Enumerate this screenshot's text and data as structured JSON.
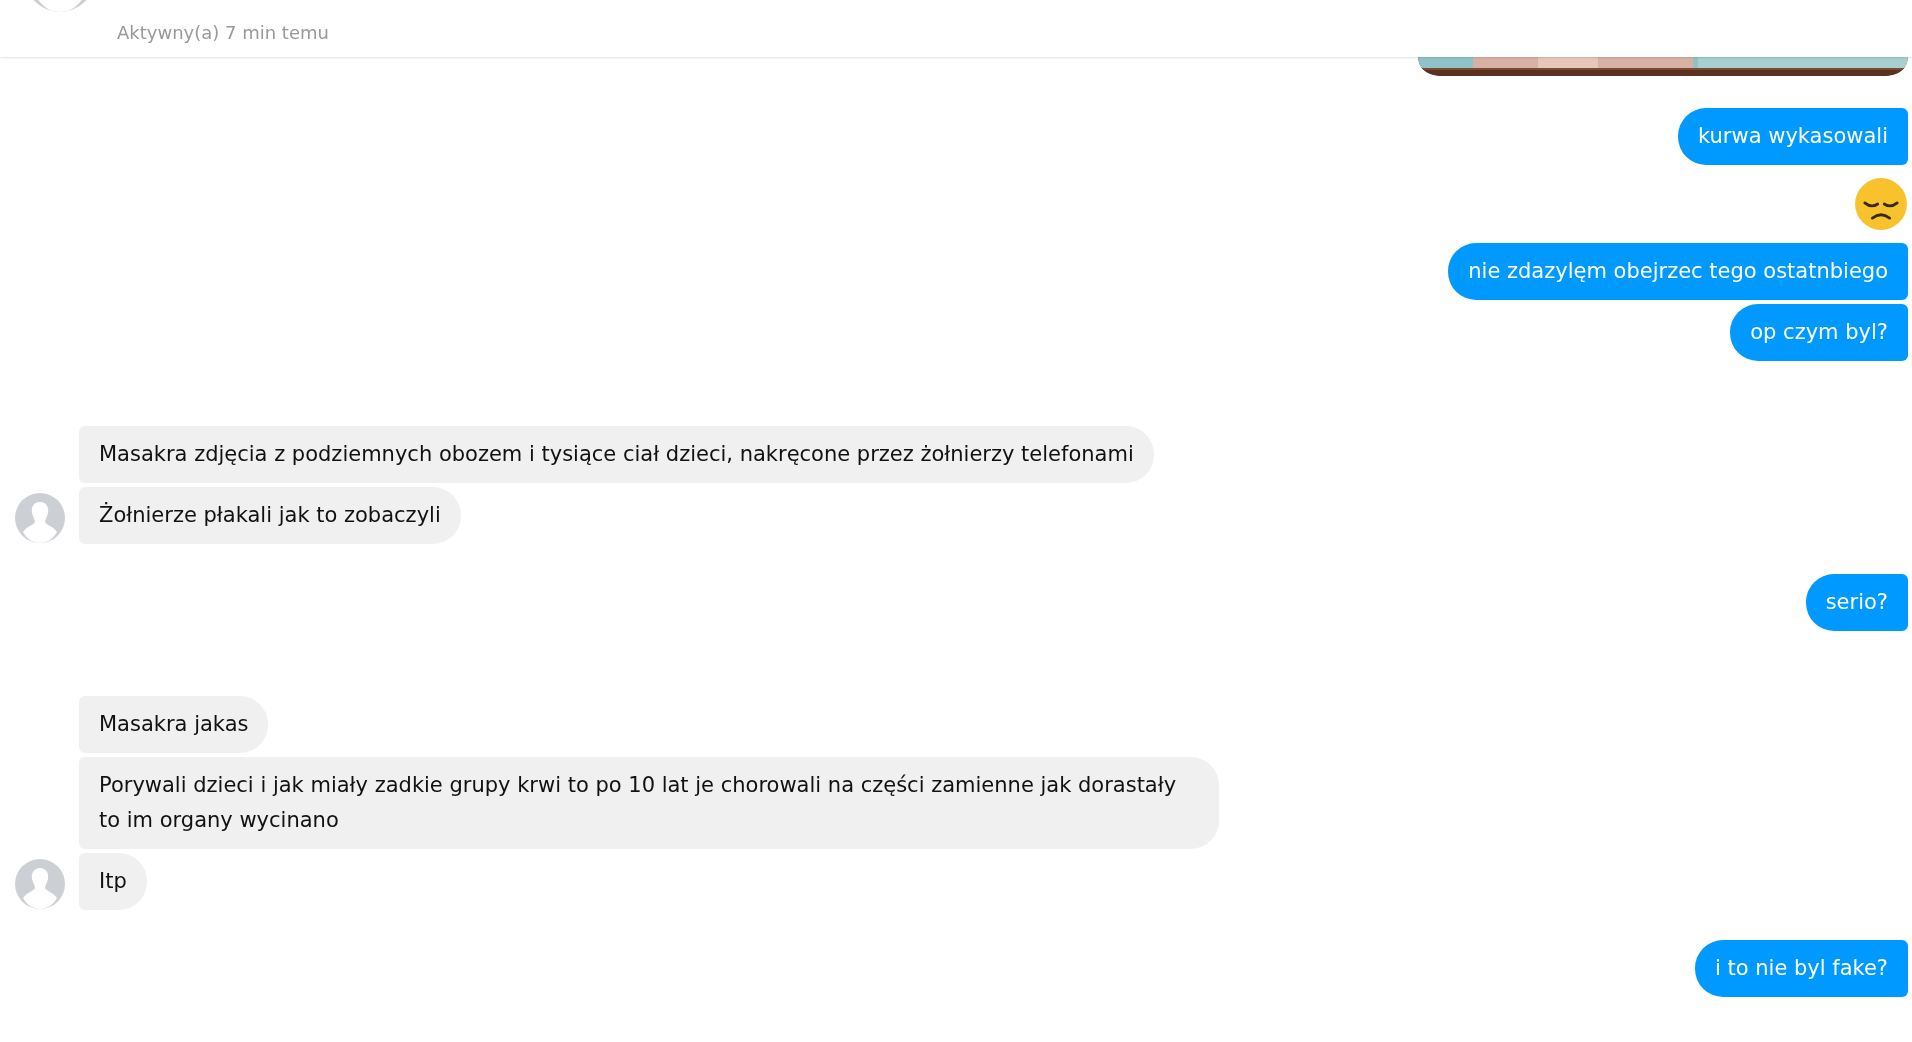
{
  "header": {
    "status": "Aktywny(a) 7 min temu"
  },
  "groups": [
    {
      "kind": "outgoing",
      "messages": [
        {
          "kind": "picture"
        },
        {
          "kind": "text",
          "text": "kurwa wykasowali"
        },
        {
          "kind": "emoji"
        },
        {
          "kind": "text",
          "text": "nie zdazylęm obejrzec tego ostatnbiego"
        },
        {
          "kind": "text",
          "text": "op czym byl?"
        }
      ]
    },
    {
      "kind": "incoming",
      "messages": [
        {
          "kind": "text",
          "text": "Masakra zdjęcia z podziemnych obozem i tysiące ciał dzieci, nakręcone przez żołnierzy telefonami"
        },
        {
          "kind": "text",
          "text": "Żołnierze płakali jak to zobaczyli"
        }
      ]
    },
    {
      "kind": "outgoing",
      "messages": [
        {
          "kind": "text",
          "text": "serio?"
        }
      ]
    },
    {
      "kind": "incoming",
      "messages": [
        {
          "kind": "text",
          "text": "Masakra jakas"
        },
        {
          "kind": "text",
          "text": "Porywali dzieci i jak miały zadkie grupy krwi to po 10 lat je chorowali na części zamienne jak dorastały to im organy wycinano"
        },
        {
          "kind": "text",
          "text": "Itp"
        }
      ]
    },
    {
      "kind": "outgoing",
      "messages": [
        {
          "kind": "text",
          "text": "i to nie byl fake?"
        }
      ]
    }
  ]
}
